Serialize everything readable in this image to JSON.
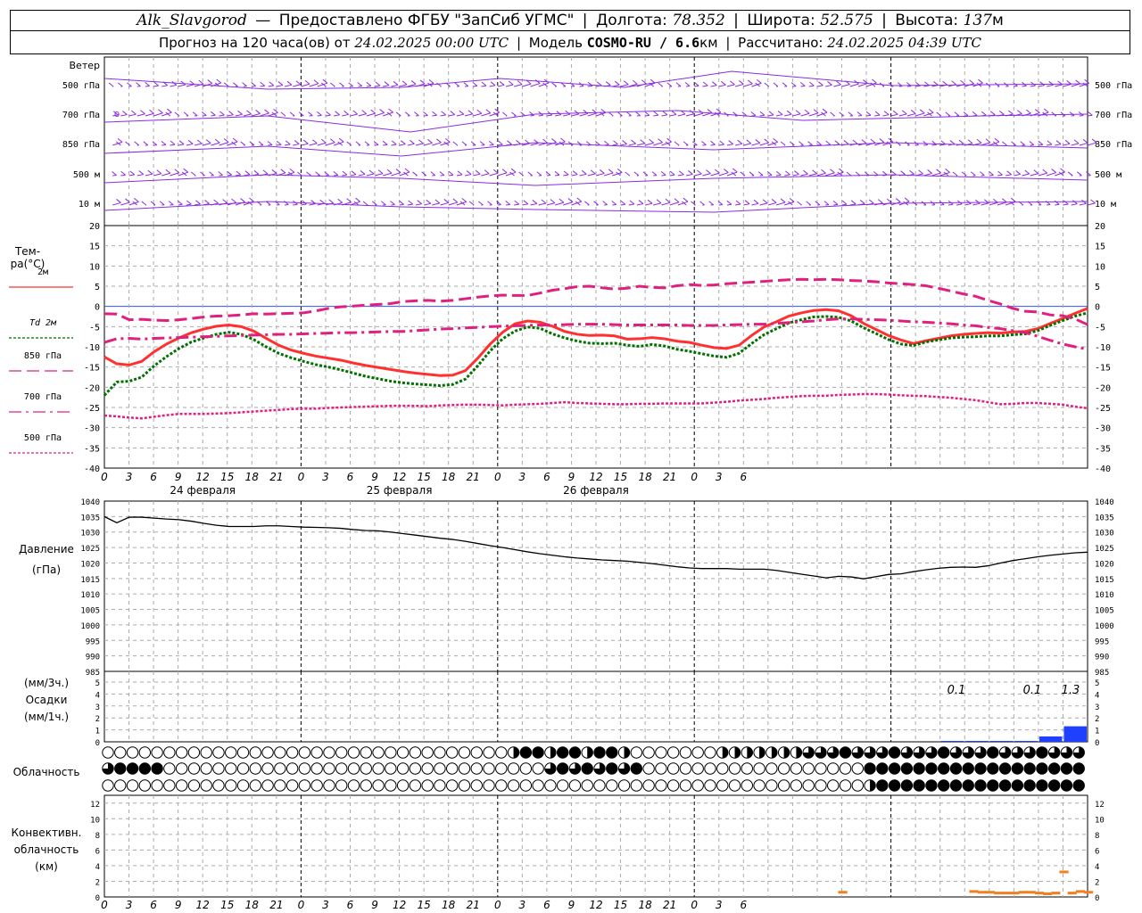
{
  "header": {
    "station": "Alk_Slavgorod",
    "dash": "—",
    "provider": "Предоставлено ФГБУ \"ЗапСиб УГМС\"",
    "lon_label": "Долгота:",
    "lon_value": "78.352",
    "lat_label": "Широта:",
    "lat_value": "52.575",
    "alt_label": "Высота:",
    "alt_value": "137",
    "alt_unit": "м",
    "forecast_prefix": "Прогноз на 120 часа(ов) от",
    "forecast_start": "24.02.2025 00:00 UTC",
    "model_label": "Модель",
    "model_name": "COSMO-RU / 6.6",
    "model_unit": "км",
    "computed_label": "Рассчитано:",
    "computed_time": "24.02.2025 04:39 UTC"
  },
  "time_axis": {
    "hour_labels": [
      "0",
      "3",
      "6",
      "9",
      "12",
      "15",
      "18",
      "21",
      "0",
      "3",
      "6",
      "9",
      "12",
      "15",
      "18",
      "21",
      "0",
      "3",
      "6",
      "9",
      "12",
      "15",
      "18",
      "21",
      "0",
      "3",
      "6"
    ],
    "day_labels": [
      "24 февраля",
      "25 февраля",
      "26 февраля"
    ]
  },
  "wind_panel": {
    "title": "Ветер",
    "levels": [
      "500 гПа",
      "700 гПа",
      "850 гПа",
      "500 м",
      "10 м"
    ],
    "calm_symbol": "o"
  },
  "temp_panel": {
    "title": "Тем-ра(°С)",
    "y_ticks": [
      "20",
      "15",
      "10",
      "5",
      "0",
      "-5",
      "-10",
      "-15",
      "-20",
      "-25",
      "-30",
      "-35",
      "-40"
    ],
    "legend": [
      {
        "label": "2м",
        "color": "#ff3030"
      },
      {
        "label": "Td  2м",
        "color": "#007000"
      },
      {
        "label": "850 гПа",
        "color": "#e0207f"
      },
      {
        "label": "700 гПа",
        "color": "#e0207f"
      },
      {
        "label": "500 гПа",
        "color": "#e0207f"
      }
    ]
  },
  "pressure_panel": {
    "title_1": "Давление",
    "title_2": "(гПа)",
    "y_ticks": [
      "1040",
      "1035",
      "1030",
      "1025",
      "1020",
      "1015",
      "1010",
      "1005",
      "1000",
      "995",
      "990",
      "985"
    ]
  },
  "precip_panel": {
    "title_1": "(мм/3ч.)",
    "title_2": "Осадки",
    "title_3": "(мм/1ч.)",
    "y_ticks": [
      "5",
      "4",
      "3",
      "2",
      "1",
      "0"
    ],
    "annotations": [
      "0.1",
      "0.1",
      "1.3"
    ],
    "color": "#2040ff"
  },
  "cloud_panel": {
    "title": "Облачность"
  },
  "convective_panel": {
    "title_1": "Конвективн.",
    "title_2": "облачность",
    "title_3": "(км)",
    "y_ticks": [
      "12",
      "10",
      "8",
      "6",
      "4",
      "2",
      "0"
    ],
    "color": "#f08020"
  },
  "chart_data": [
    {
      "type": "line",
      "title": "Тем-ра(°С)",
      "ylim": [
        -40,
        20
      ],
      "x_hours_step": 2,
      "series": [
        {
          "name": "2м",
          "color": "#ff3030",
          "style": "solid",
          "values": [
            -12.5,
            -14.2,
            -14.5,
            -13.6,
            -11.2,
            -9.3,
            -7.8,
            -6.5,
            -5.6,
            -4.9,
            -4.6,
            -5.0,
            -6.1,
            -7.9,
            -9.6,
            -10.8,
            -11.6,
            -12.3,
            -12.8,
            -13.3,
            -14.0,
            -14.6,
            -15.1,
            -15.6,
            -16.1,
            -16.5,
            -16.8,
            -17.1,
            -17.0,
            -15.9,
            -12.8,
            -9.3,
            -6.4,
            -4.3,
            -3.6,
            -3.9,
            -4.9,
            -6.2,
            -6.9,
            -7.2,
            -7.1,
            -7.3,
            -8.1,
            -8.0,
            -7.7,
            -8.0,
            -8.6,
            -8.9,
            -9.6,
            -10.2,
            -10.4,
            -9.6,
            -7.2,
            -5.1,
            -3.8,
            -2.4,
            -1.6,
            -1.0,
            -0.8,
            -1.1,
            -2.3,
            -4.2,
            -5.7,
            -7.2,
            -8.3,
            -9.2,
            -8.5,
            -7.9,
            -7.3,
            -6.9,
            -6.7,
            -6.5,
            -6.6,
            -6.3,
            -6.2,
            -5.5,
            -4.2,
            -3.0,
            -1.7,
            -0.5
          ]
        },
        {
          "name": "Td 2м",
          "color": "#007000",
          "style": "dotted",
          "values": [
            -22.0,
            -18.7,
            -18.5,
            -17.5,
            -14.7,
            -12.4,
            -10.4,
            -8.8,
            -7.8,
            -6.9,
            -6.4,
            -6.9,
            -8.2,
            -10.0,
            -11.6,
            -12.7,
            -13.6,
            -14.4,
            -15.0,
            -15.7,
            -16.5,
            -17.3,
            -17.9,
            -18.5,
            -18.9,
            -19.2,
            -19.4,
            -19.6,
            -19.3,
            -18.0,
            -14.7,
            -11.0,
            -8.0,
            -6.1,
            -5.1,
            -5.4,
            -6.8,
            -7.8,
            -8.6,
            -9.1,
            -9.2,
            -9.1,
            -9.6,
            -9.9,
            -9.4,
            -9.8,
            -10.6,
            -11.1,
            -11.7,
            -12.3,
            -12.6,
            -11.6,
            -9.2,
            -7.0,
            -5.5,
            -4.1,
            -3.3,
            -2.6,
            -2.5,
            -2.7,
            -3.6,
            -5.3,
            -6.7,
            -8.2,
            -9.3,
            -9.7,
            -8.8,
            -8.3,
            -7.8,
            -7.6,
            -7.5,
            -7.3,
            -7.3,
            -7.0,
            -6.8,
            -6.0,
            -4.7,
            -3.5,
            -2.4,
            -1.6
          ]
        },
        {
          "name": "850 гПа",
          "color": "#e0207f",
          "style": "dash",
          "values": [
            -1.8,
            -1.9,
            -3.3,
            -3.2,
            -3.4,
            -3.5,
            -3.3,
            -3.0,
            -2.6,
            -2.4,
            -2.3,
            -2.1,
            -1.8,
            -1.9,
            -1.8,
            -1.7,
            -1.6,
            -1.1,
            -0.5,
            -0.1,
            0.1,
            0.3,
            0.5,
            0.7,
            1.2,
            1.4,
            1.5,
            1.3,
            1.5,
            1.9,
            2.3,
            2.6,
            2.8,
            2.7,
            2.7,
            3.3,
            4.0,
            4.4,
            4.9,
            5.0,
            4.6,
            4.3,
            4.5,
            5.0,
            4.7,
            4.6,
            5.1,
            5.4,
            5.2,
            5.3,
            5.6,
            5.8,
            6.0,
            6.2,
            6.4,
            6.6,
            6.7,
            6.6,
            6.7,
            6.6,
            6.4,
            6.3,
            6.1,
            5.8,
            5.6,
            5.4,
            5.1,
            4.5,
            3.8,
            3.1,
            2.5,
            1.5,
            0.6,
            -0.5,
            -1.2,
            -1.4,
            -2.1,
            -2.3,
            -3.1,
            -4.5
          ]
        },
        {
          "name": "700 гПа",
          "color": "#e0207f",
          "style": "dashdot",
          "values": [
            -8.9,
            -8.0,
            -7.9,
            -8.1,
            -7.9,
            -7.8,
            -7.7,
            -7.6,
            -7.5,
            -7.4,
            -7.3,
            -7.2,
            -7.1,
            -7.0,
            -6.9,
            -6.9,
            -6.8,
            -6.7,
            -6.6,
            -6.5,
            -6.5,
            -6.4,
            -6.3,
            -6.2,
            -6.2,
            -6.0,
            -5.8,
            -5.6,
            -5.5,
            -5.3,
            -5.2,
            -5.0,
            -4.9,
            -4.8,
            -4.7,
            -4.6,
            -4.6,
            -4.5,
            -4.4,
            -4.4,
            -4.4,
            -4.5,
            -4.6,
            -4.6,
            -4.6,
            -4.6,
            -4.6,
            -4.7,
            -4.7,
            -4.7,
            -4.6,
            -4.5,
            -4.4,
            -4.4,
            -4.2,
            -4.0,
            -3.8,
            -3.6,
            -3.3,
            -3.1,
            -3.1,
            -3.2,
            -3.3,
            -3.4,
            -3.6,
            -3.8,
            -3.9,
            -4.1,
            -4.3,
            -4.6,
            -4.8,
            -5.2,
            -5.5,
            -6.0,
            -6.5,
            -7.4,
            -8.4,
            -9.3,
            -10.0,
            -10.6
          ]
        },
        {
          "name": "500 гПа",
          "color": "#e0207f",
          "style": "dotted",
          "values": [
            -27.0,
            -27.2,
            -27.5,
            -27.7,
            -27.3,
            -26.9,
            -26.6,
            -26.6,
            -26.6,
            -26.5,
            -26.4,
            -26.2,
            -26.0,
            -25.8,
            -25.6,
            -25.4,
            -25.3,
            -25.3,
            -25.1,
            -25.0,
            -24.9,
            -24.8,
            -24.7,
            -24.6,
            -24.6,
            -24.6,
            -24.7,
            -24.5,
            -24.4,
            -24.3,
            -24.3,
            -24.4,
            -24.5,
            -24.3,
            -24.2,
            -24.1,
            -23.9,
            -23.7,
            -23.9,
            -24.0,
            -24.1,
            -24.2,
            -24.2,
            -24.1,
            -24.1,
            -24.0,
            -24.0,
            -24.0,
            -24.0,
            -23.8,
            -23.6,
            -23.3,
            -23.1,
            -22.9,
            -22.6,
            -22.4,
            -22.2,
            -22.1,
            -22.1,
            -21.9,
            -21.8,
            -21.7,
            -21.7,
            -21.8,
            -22.0,
            -22.1,
            -22.2,
            -22.4,
            -22.6,
            -22.9,
            -23.2,
            -23.7,
            -24.2,
            -24.1,
            -23.9,
            -23.9,
            -24.1,
            -24.3,
            -24.8,
            -25.2
          ]
        }
      ]
    },
    {
      "type": "line",
      "title": "Давление (гПа)",
      "ylim": [
        985,
        1040
      ],
      "x_hours_step": 2,
      "series": [
        {
          "name": "Давление",
          "color": "#000000",
          "style": "solid",
          "values": [
            1035.0,
            1033.0,
            1034.8,
            1034.8,
            1034.5,
            1034.2,
            1034.0,
            1033.5,
            1032.8,
            1032.2,
            1031.8,
            1031.8,
            1031.8,
            1032.0,
            1032.0,
            1031.8,
            1031.6,
            1031.5,
            1031.4,
            1031.2,
            1030.8,
            1030.5,
            1030.4,
            1030.0,
            1029.5,
            1029.0,
            1028.5,
            1028.0,
            1027.6,
            1027.0,
            1026.3,
            1025.6,
            1025.0,
            1024.3,
            1023.6,
            1023.0,
            1022.5,
            1022.0,
            1021.6,
            1021.3,
            1021.0,
            1020.8,
            1020.6,
            1020.2,
            1019.8,
            1019.3,
            1018.8,
            1018.4,
            1018.2,
            1018.2,
            1018.2,
            1018.0,
            1018.0,
            1018.0,
            1017.6,
            1017.0,
            1016.4,
            1015.8,
            1015.2,
            1015.7,
            1015.5,
            1014.9,
            1015.6,
            1016.3,
            1016.5,
            1017.2,
            1017.8,
            1018.3,
            1018.6,
            1018.7,
            1018.6,
            1019.1,
            1020.0,
            1020.8,
            1021.4,
            1022.0,
            1022.5,
            1022.9,
            1023.3,
            1023.5
          ]
        }
      ]
    },
    {
      "type": "bar",
      "title": "Осадки (мм/3ч.)",
      "ylim": [
        0,
        5
      ],
      "x_hours": [
        105,
        108,
        111,
        114,
        117,
        120
      ],
      "values": [
        0.03,
        0.02,
        0.04,
        0.04,
        0.45,
        1.3
      ]
    },
    {
      "type": "bar",
      "title": "Конвективн. облачность (км)",
      "ylim": [
        0,
        13
      ],
      "x_hours": [
        84,
        85,
        86,
        87,
        88,
        89,
        90,
        91,
        92,
        93,
        94,
        95,
        96,
        97,
        98,
        99,
        100,
        101,
        102,
        103,
        104,
        105,
        106,
        107,
        108,
        109,
        110,
        111,
        112,
        113,
        114,
        115,
        116,
        117,
        118,
        119,
        120
      ],
      "values": [
        0,
        0,
        0,
        0,
        0,
        0,
        0.6,
        0,
        0,
        0,
        0,
        0,
        0,
        0,
        0,
        0,
        0,
        0,
        0,
        0,
        0,
        0,
        0.7,
        0.6,
        0.6,
        0.5,
        0.5,
        0.5,
        0.6,
        0.6,
        0.5,
        0.4,
        0.5,
        3.2,
        0.5,
        0.7,
        0.6
      ]
    }
  ]
}
